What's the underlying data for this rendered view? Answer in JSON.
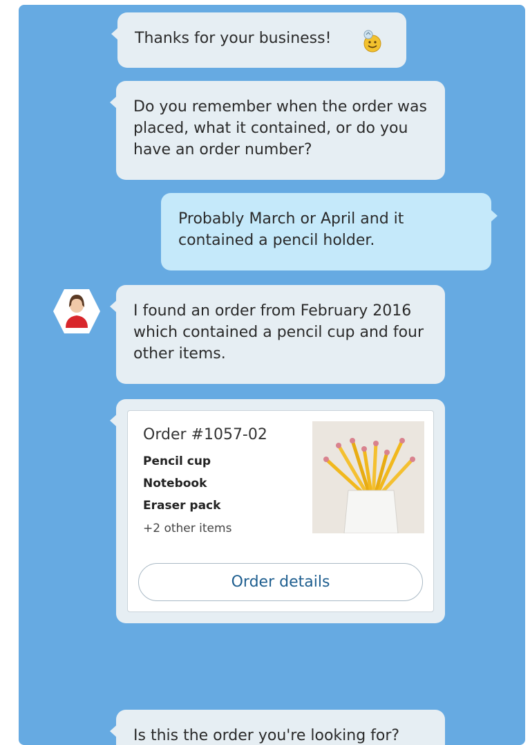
{
  "messages": [
    {
      "sender": "bot",
      "text": "Thanks for your business!",
      "icon": "smiley-emoji-icon"
    },
    {
      "sender": "bot",
      "text": "Do you remember when the order was placed, what it contained, or do you have an order number?"
    },
    {
      "sender": "user",
      "text": "Probably March or April and it contained a pencil holder."
    },
    {
      "sender": "bot",
      "text": "I found an order from February 2016 which contained a pencil cup and four other items.",
      "avatar": "agent-avatar"
    },
    {
      "sender": "bot",
      "text": "Is this the order you're looking for?"
    }
  ],
  "order_card": {
    "title": "Order #1057-02",
    "items": [
      "Pencil cup",
      "Notebook",
      "Eraser pack"
    ],
    "more": "+2 other items",
    "image": "pencil-cup-image",
    "button_label": "Order details"
  },
  "colors": {
    "panel_bg": "#66aae2",
    "bot_bubble": "#e6eef3",
    "user_bubble": "#c5e9fa",
    "button_text": "#1e5e8f"
  }
}
